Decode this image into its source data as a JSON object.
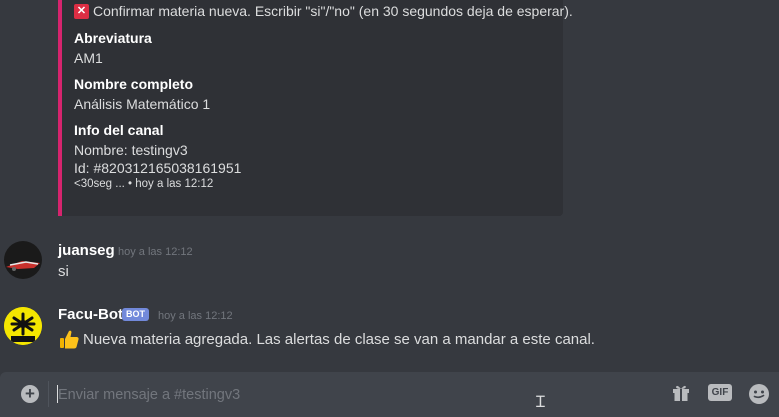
{
  "embed": {
    "title_text": "Confirmar materia nueva. Escribir \"si\"/\"no\" (en 30 segundos deja de esperar).",
    "fields": [
      {
        "name": "Abreviatura",
        "value": "AM1"
      },
      {
        "name": "Nombre completo",
        "value": "Análisis Matemático 1"
      },
      {
        "name": "Info del canal",
        "value_lines": [
          "Nombre: testingv3",
          "Id: #820312165038161951"
        ]
      }
    ],
    "footer": "<30seg ... • hoy a las 12:12",
    "accent_color": "#d6246e"
  },
  "messages": [
    {
      "username": "juanseg",
      "timestamp": "hoy a las 12:12",
      "text": "si"
    },
    {
      "username": "Facu-Bot",
      "badge": "BOT",
      "timestamp": "hoy a las 12:12",
      "text": "Nueva materia agregada. Las alertas de clase se van a mandar a este canal.",
      "emoji": "thumbs-up"
    }
  ],
  "composer": {
    "placeholder": "Enviar mensaje a #testingv3",
    "gif_label": "GIF",
    "icons": [
      "add-icon",
      "gift-icon",
      "gif-icon",
      "emoji-icon"
    ]
  }
}
